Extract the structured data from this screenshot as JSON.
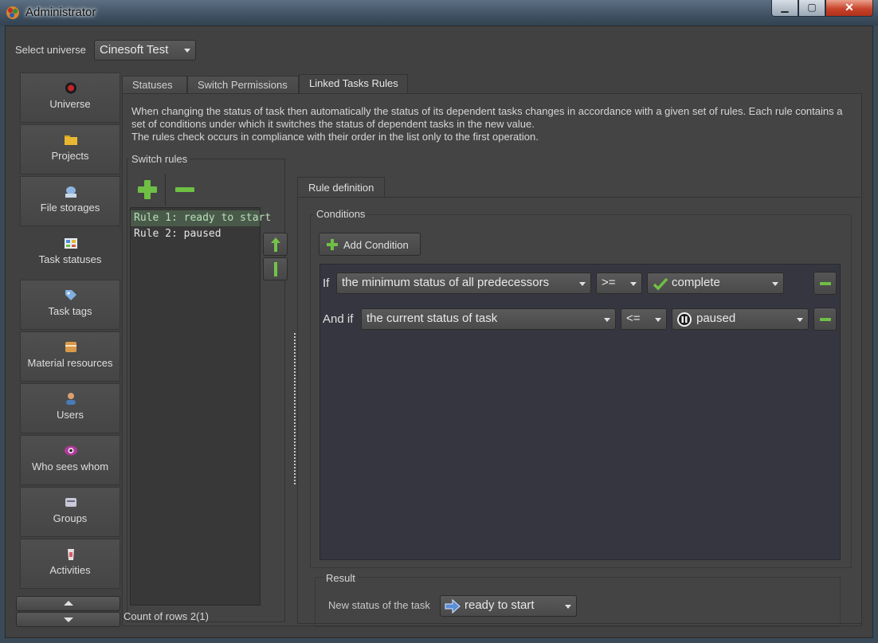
{
  "window": {
    "title": "Administrator",
    "controls": {
      "minimize": "▁",
      "maximize": "▢",
      "close": "✕"
    }
  },
  "universe": {
    "label": "Select universe",
    "selected": "Cinesoft Test"
  },
  "sidebar": {
    "items": [
      {
        "label": "Universe",
        "icon": "universe-icon",
        "color": "#c0262a"
      },
      {
        "label": "Projects",
        "icon": "folder-icon",
        "color": "#e8b830"
      },
      {
        "label": "File storages",
        "icon": "file-storage-icon",
        "color": "#8fb6e0"
      },
      {
        "label": "Task statuses",
        "icon": "task-status-icon",
        "color": "#6aa0d8"
      },
      {
        "label": "Task tags",
        "icon": "tag-icon",
        "color": "#7fb0e0"
      },
      {
        "label": "Material resources",
        "icon": "box-icon",
        "color": "#d89a4a"
      },
      {
        "label": "Users",
        "icon": "user-icon",
        "color": "#d8a070"
      },
      {
        "label": "Who sees whom",
        "icon": "eye-icon",
        "color": "#b03a9a"
      },
      {
        "label": "Groups",
        "icon": "group-icon",
        "color": "#c8c8d8"
      },
      {
        "label": "Activities",
        "icon": "activity-icon",
        "color": "#d85a6a"
      }
    ],
    "active_index": 3
  },
  "tabs": [
    {
      "label": "Statuses"
    },
    {
      "label": "Switch Permissions"
    },
    {
      "label": "Linked Tasks Rules"
    }
  ],
  "description": "When changing the status of task then automatically the status of its dependent tasks changes in accordance with a given set of rules. Each rule contains a set of conditions under which it switches the status of dependent tasks in the new value.\nThe rules check occurs in compliance with their order in the list only to the first operation.",
  "switch_rules": {
    "label": "Switch rules",
    "rules": [
      "Rule 1: ready to start",
      "Rule 2: paused"
    ],
    "selected_index": 0,
    "count_text": "Count of rows 2(1)"
  },
  "rule_definition": {
    "tab_label": "Rule definition",
    "conditions_title": "Conditions",
    "add_condition_label": "Add Condition",
    "conditions": [
      {
        "prefix": "If",
        "subject": "the minimum status of all predecessors",
        "operator": ">=",
        "status": "complete",
        "status_icon": "check-icon"
      },
      {
        "prefix": "And if",
        "subject": "the current status of task",
        "operator": "<=",
        "status": "paused",
        "status_icon": "pause-icon"
      }
    ],
    "result": {
      "title": "Result",
      "label": "New status of the task",
      "value": "ready to start",
      "value_icon": "arrow-right-icon"
    }
  },
  "colors": {
    "accent_green": "#6fbf45",
    "selection_bg": "#4a5a4a",
    "selection_text": "#b8e0b8"
  }
}
